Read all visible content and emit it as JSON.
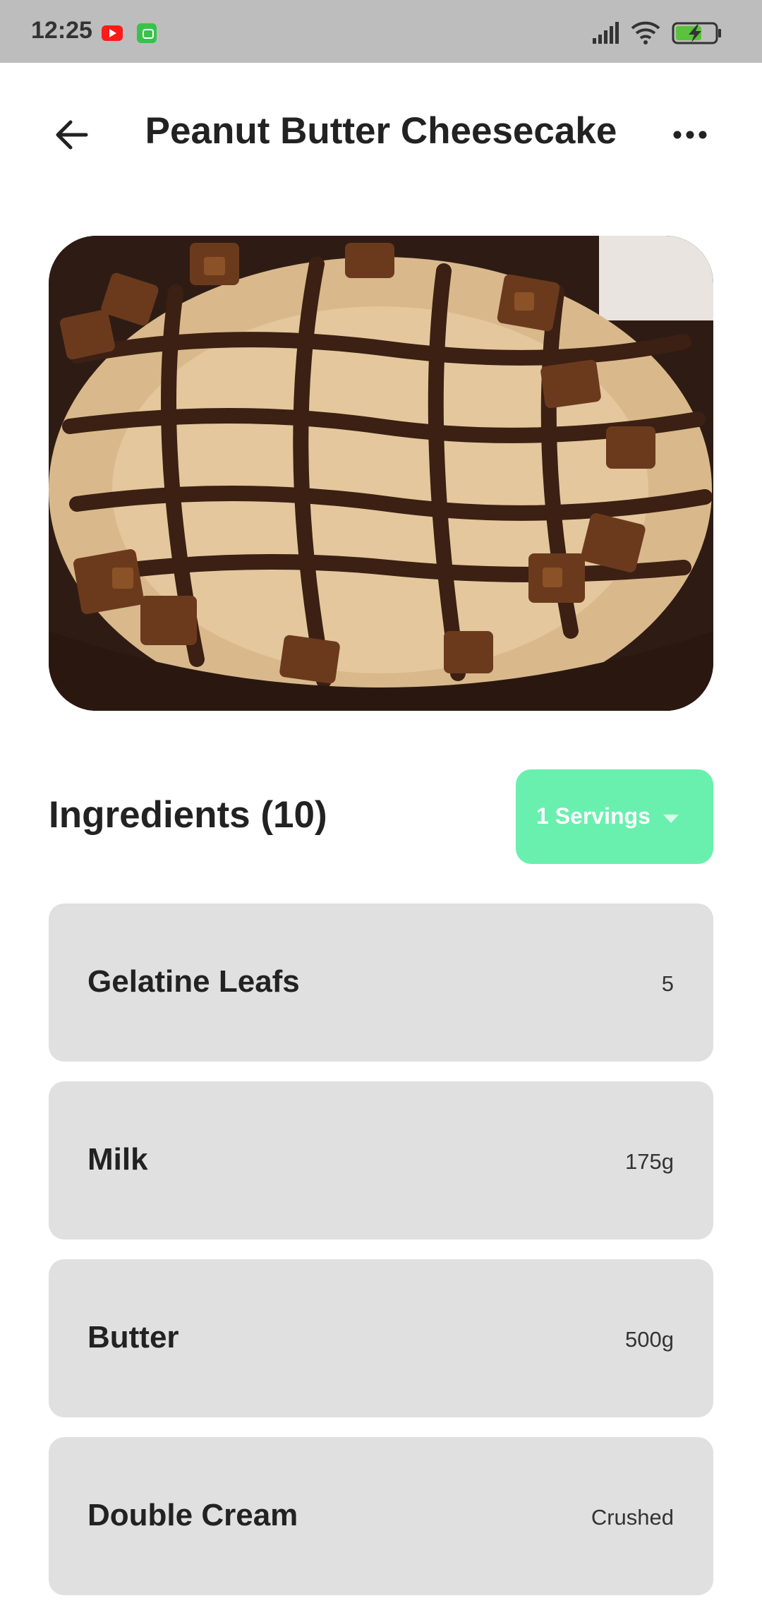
{
  "status_bar": {
    "time": "12:25",
    "icons": [
      "youtube-icon",
      "app-notification-icon",
      "signal-icon",
      "wifi-icon",
      "battery-charging-icon"
    ]
  },
  "header": {
    "title": "Peanut Butter Cheesecake",
    "back_icon": "arrow-left-icon",
    "more_icon": "more-horizontal-icon"
  },
  "hero": {
    "image_subject": "peanut-butter-cheesecake-photo"
  },
  "ingredients": {
    "title": "Ingredients (10)",
    "servings_label": "1 Servings",
    "items": [
      {
        "name": "Gelatine Leafs",
        "quantity": "5"
      },
      {
        "name": "Milk",
        "quantity": "175g"
      },
      {
        "name": "Butter",
        "quantity": "500g"
      },
      {
        "name": "Double Cream",
        "quantity": "Crushed"
      }
    ]
  },
  "colors": {
    "status_bar": "#bdbdbd",
    "accent": "#69f0ae",
    "card": "#e0e0e0",
    "text": "#222222"
  }
}
